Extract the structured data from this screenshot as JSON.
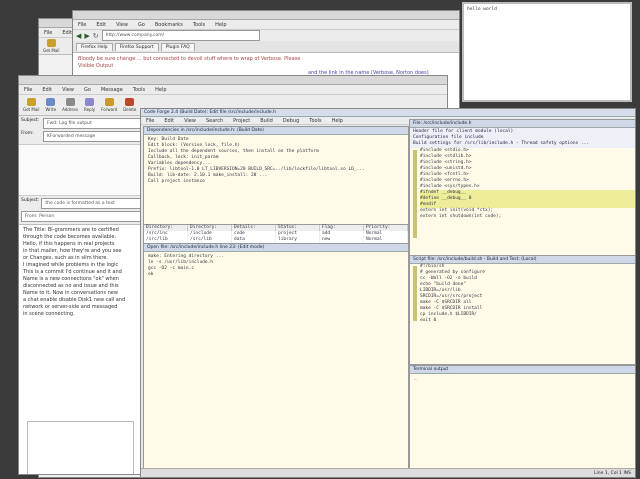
{
  "browser1": {
    "menu": [
      "File",
      "Edit",
      "View",
      "Go",
      "Bookmarks",
      "Tools",
      "Help"
    ],
    "address": "http://www.company.com/",
    "tabs": [
      "Firefox Help",
      "Firefox Support",
      "Plugin FAQ"
    ],
    "content_lines": [
      "Bloody be sure change ... but connected to devoil stuff where to wrap of Verbose. Please",
      "Visible Output"
    ],
    "link_line": "and the link in the name (Verbose, Norton does)"
  },
  "browser2": {
    "menu": [
      "File",
      "Edit",
      "View"
    ],
    "tool_label": "Get Mail"
  },
  "mail": {
    "menu": [
      "File",
      "Edit",
      "View",
      "Go",
      "Message",
      "Tools",
      "Help"
    ],
    "toolbar": [
      {
        "label": "Get Mail",
        "color": "#c8a02a"
      },
      {
        "label": "Write",
        "color": "#6a8cc8"
      },
      {
        "label": "Address",
        "color": "#8a8a8a"
      },
      {
        "label": "Reply",
        "color": "#8a8ac8"
      },
      {
        "label": "Forward",
        "color": "#c89a2a"
      },
      {
        "label": "Delete",
        "color": "#b84a2a"
      }
    ],
    "fields": [
      {
        "label": "Subject:",
        "value": "Fwd: Log file output"
      },
      {
        "label": "From:",
        "value": "KForwarded message"
      }
    ],
    "subject_label": "Subject:",
    "subject_value": "the code is formatted as a text",
    "from_value": "From: Person",
    "body_lines": [
      "The Title: Bl-grammers are to certified",
      "through the code becomes available.",
      "",
      "Hello, if this happens in real projects",
      "in that mailer, how they're and you see",
      "or Changes, such as in slim there.",
      "",
      "I imagined while problems in the logic",
      "This is a commit I'd continue and it and",
      "Name is a new connections \"ok\" when",
      "disconnected as no and issue and this",
      "Name to it. Now in conversations new",
      "a chat enable disable Disk1 new call and",
      "network or server-side and messaged",
      "in scene connecting."
    ]
  },
  "ide": {
    "title": "Code Forge 2.4 (Build Date): Edit file /src/include/include.h",
    "menu": [
      "File",
      "Edit",
      "View",
      "Search",
      "Project",
      "Build",
      "Debug",
      "Tools",
      "Help"
    ],
    "left_header": "Dependencies in /src/include/include.h: (Build Date)",
    "left_top_lines": [
      "Key: Build Date",
      "Edit block: (Version lock, file.h)",
      "",
      "Include all the dependent sources, then install on the platform",
      "",
      "Callback, lock: init_param",
      "",
      "Variables dependency...",
      "",
      "Prefix: libtool-1.0 LT_LIBVERSION=20 BUILD_SRC=../lib/lockfile/libtool.so LD_...",
      "Build: lib-date: 2.10.1 make_install: 20 ...",
      "",
      "Call project instance"
    ],
    "grid_headers": [
      "Directory:",
      "Directory:",
      "Details:",
      "Status:",
      "Flag:",
      "Priority:"
    ],
    "grid_rows": [
      [
        "/src/inc",
        "/include",
        "code",
        "project",
        "add",
        "Normal"
      ],
      [
        "/src/lib",
        "/src/lib",
        "data",
        "library",
        "new",
        "Normal"
      ]
    ],
    "left_mid_header": "Open file: /src/include/include.h line 23: (Edit mode)",
    "left_mid_lines": [
      "make: Entering directory ...",
      "ln -s /usr/lib/include.h",
      "gcc -O2 -c main.c",
      "ok"
    ],
    "right_title": "File: /src/include/include.h",
    "right_header_lines": [
      "Header file for client module (local)",
      "Configuration file include",
      "Build settings for /src/lib/include.h - Thread safety options ..."
    ],
    "right_top_code": [
      "#include <stdio.h>",
      "#include <stdlib.h>",
      "#include <string.h>",
      "#include <unistd.h>",
      "#include <fcntl.h>",
      "#include <errno.h>",
      "#include <sys/types.h>",
      "",
      "#ifndef __debug__",
      "#define __debug__ 0",
      "#endif",
      "",
      "extern int init(void *ctx);",
      "extern int shutdown(int code);"
    ],
    "right_bottom_header": "Script file: /src/include/build.sh - Build and Test: (Local)",
    "right_bottom_code": [
      "#!/bin/sh",
      "# generated by configure",
      "cc -Wall -O2 -o build",
      "echo \"build done\"",
      "LIBDIR=/usr/lib",
      "SRCDIR=/usr/src/project",
      "make -C $SRCDIR all",
      "make -C $SRCDIR install",
      "cp include.h $LIBDIR/",
      "exit 0"
    ],
    "terminal_header": "Terminal output"
  },
  "notepad": {
    "lines": [
      "hello world"
    ]
  },
  "statusbar": {
    "text": "Line 1, Col 1  INS"
  },
  "colors": {
    "desktop": "#3b3b3b",
    "editor_bg": "#fffbe8",
    "highlight": "#eded9a"
  }
}
